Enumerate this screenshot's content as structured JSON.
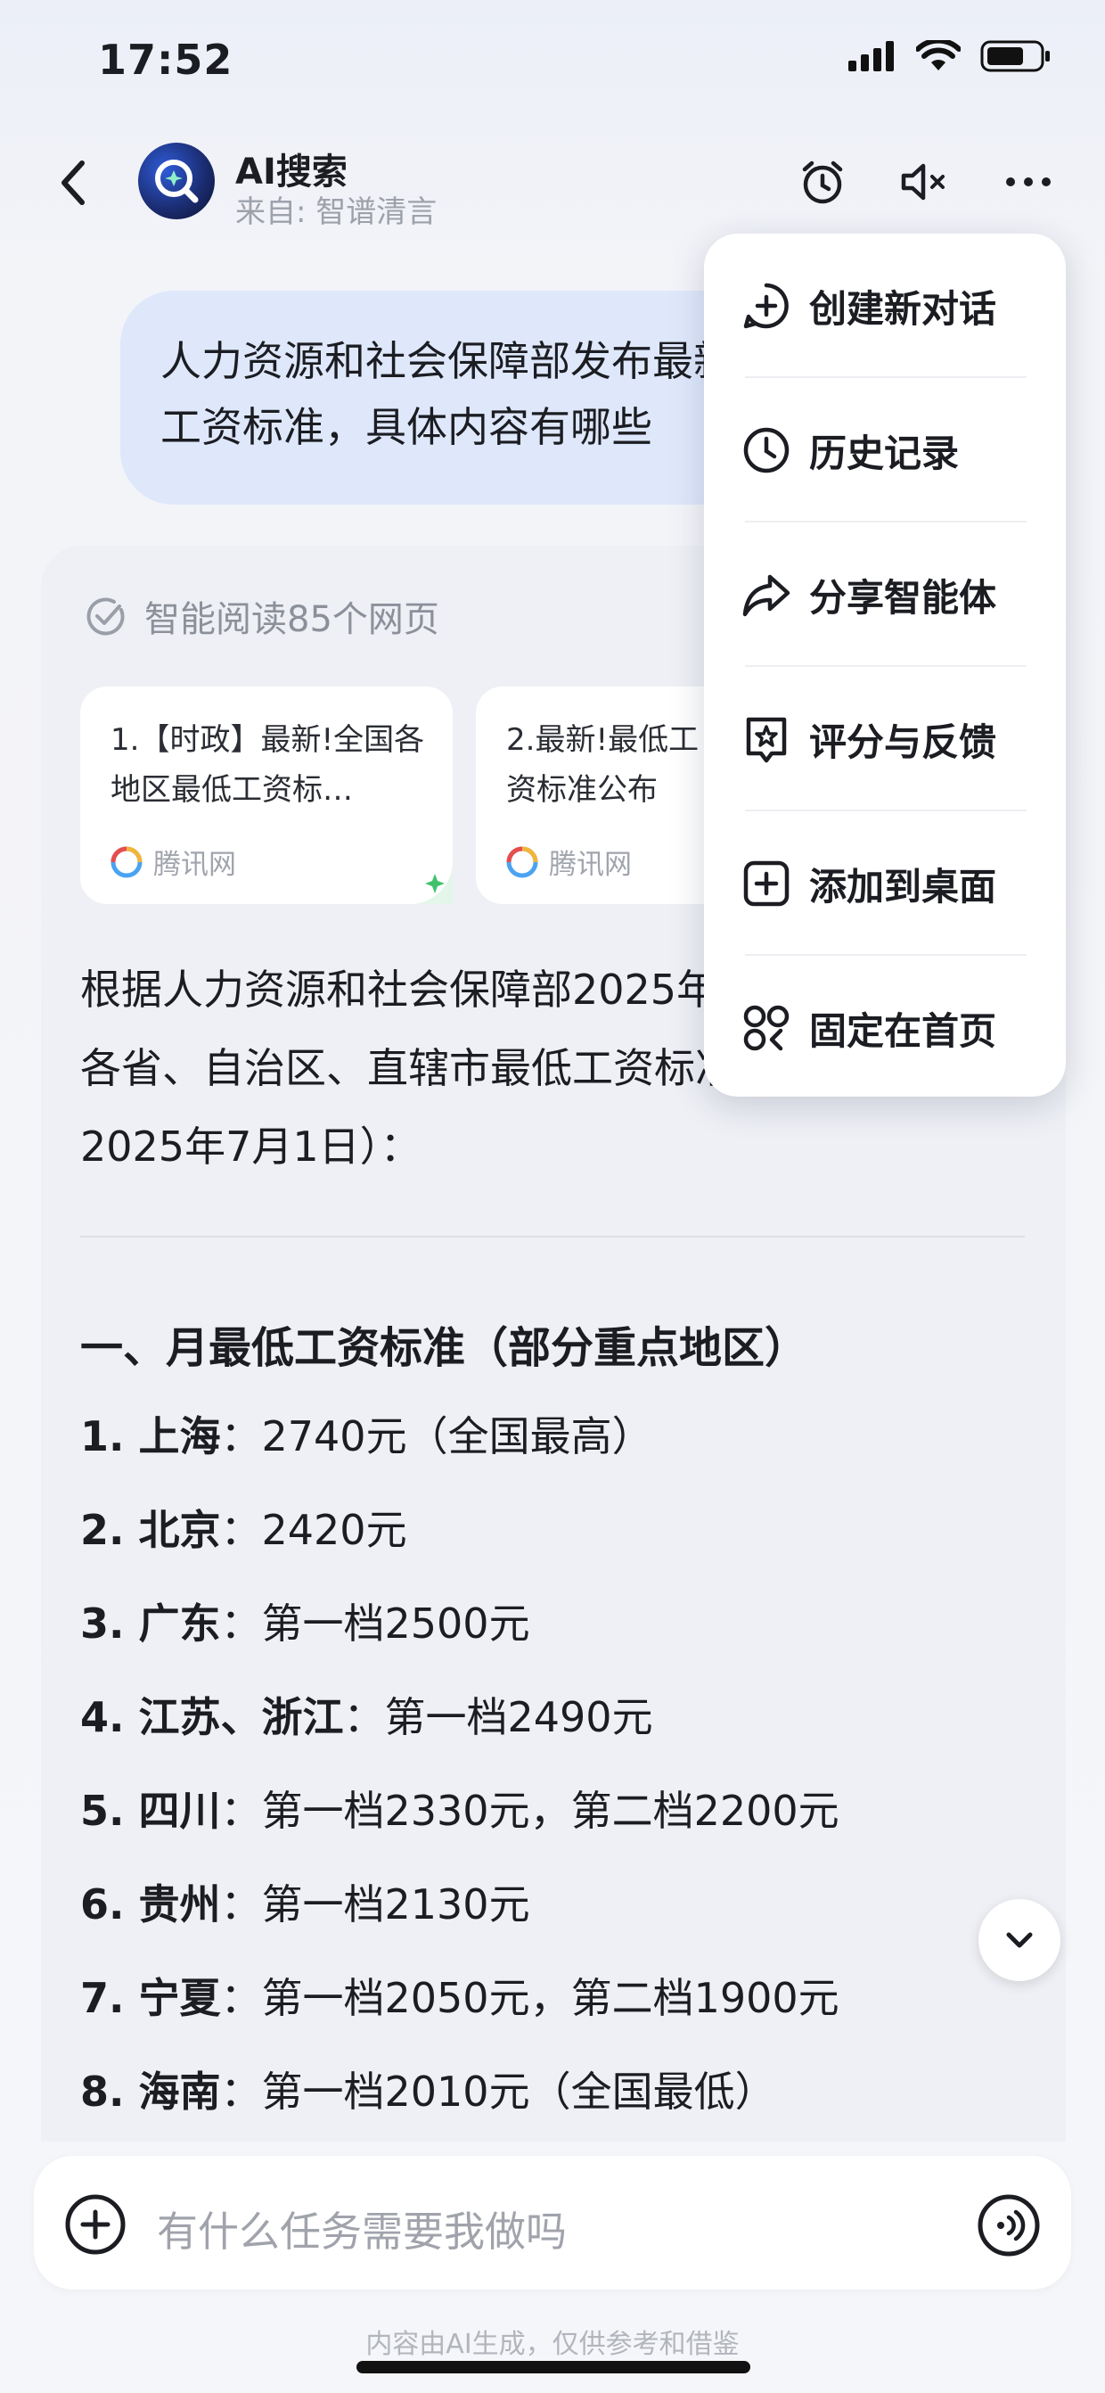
{
  "status": {
    "time": "17:52"
  },
  "header": {
    "title": "AI搜索",
    "subtitle": "来自: 智谱清言"
  },
  "user_message": "人力资源和社会保障部发布最新最低工资标准，具体内容有哪些",
  "answer": {
    "reading_status": "智能阅读85个网页",
    "sources": [
      {
        "title": "1.【时政】最新!全国各地区最低工资标…",
        "site": "腾讯网"
      },
      {
        "title": "2.最新!最低工资标准公布",
        "site": "腾讯网"
      }
    ],
    "intro": "根据人力资源和社会保障部2025年的最新数据，全国各省、自治区、直辖市最低工资标准情况如下（截至2025年7月1日）：",
    "section_title": "一、月最低工资标准（部分重点地区）",
    "items": [
      {
        "label": "1. 上海",
        "value": "：2740元（全国最高）"
      },
      {
        "label": "2. 北京",
        "value": "：2420元"
      },
      {
        "label": "3. 广东",
        "value": "：第一档2500元"
      },
      {
        "label": "4. 江苏、浙江",
        "value": "：第一档2490元"
      },
      {
        "label": "5. 四川",
        "value": "：第一档2330元，第二档2200元"
      },
      {
        "label": "6. 贵州",
        "value": "：第一档2130元"
      },
      {
        "label": "7. 宁夏",
        "value": "：第一档2050元，第二档1900元"
      },
      {
        "label": "8. 海南",
        "value": "：第一档2010元（全国最低）"
      }
    ]
  },
  "input": {
    "placeholder": "有什么任务需要我做吗"
  },
  "disclaimer": "内容由AI生成，仅供参考和借鉴",
  "menu": {
    "items": [
      {
        "label": "创建新对话",
        "icon": "new-chat-icon"
      },
      {
        "label": "历史记录",
        "icon": "clock-icon"
      },
      {
        "label": "分享智能体",
        "icon": "share-icon"
      },
      {
        "label": "评分与反馈",
        "icon": "rating-icon"
      },
      {
        "label": "添加到桌面",
        "icon": "add-square-icon"
      },
      {
        "label": "固定在首页",
        "icon": "pin-grid-icon"
      }
    ]
  }
}
